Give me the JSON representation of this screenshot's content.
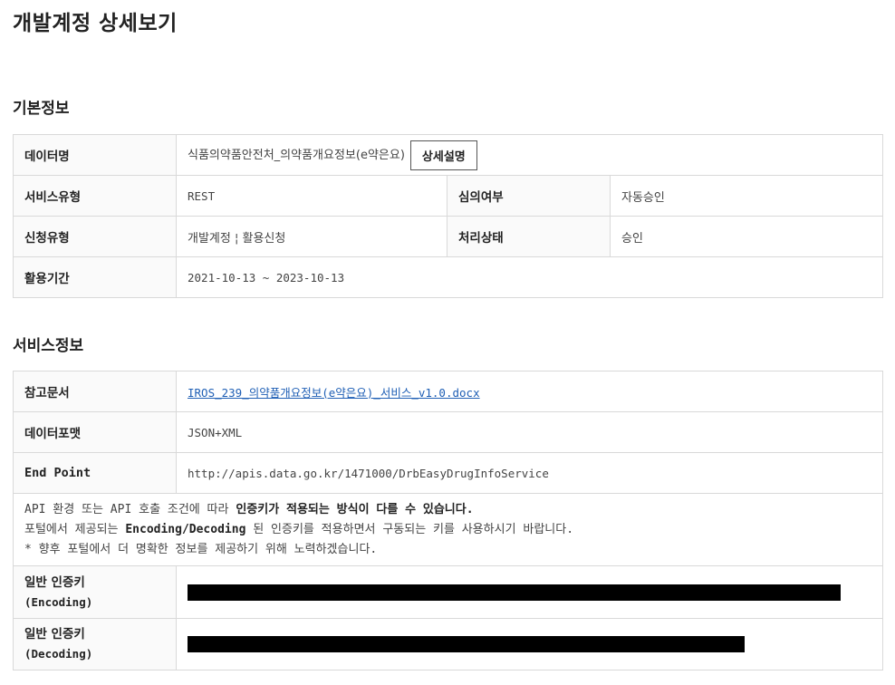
{
  "page": {
    "title": "개발계정 상세보기"
  },
  "basic_info": {
    "section_title": "기본정보",
    "data_name_label": "데이터명",
    "data_name_value": "식품의약품안전처_의약품개요정보(e약은요)",
    "detail_button_label": "상세설명",
    "service_type_label": "서비스유형",
    "service_type_value": "REST",
    "review_label": "심의여부",
    "review_value": "자동승인",
    "request_type_label": "신청유형",
    "request_type_value": "개발계정 ¦ 활용신청",
    "process_status_label": "처리상태",
    "process_status_value": "승인",
    "period_label": "활용기간",
    "period_value": "2021-10-13 ~ 2023-10-13"
  },
  "service_info": {
    "section_title": "서비스정보",
    "reference_doc_label": "참고문서",
    "reference_doc_value": "IROS_239_의약품개요정보(e약은요)_서비스_v1.0.docx",
    "data_format_label": "데이터포맷",
    "data_format_value": "JSON+XML",
    "endpoint_label": "End Point",
    "endpoint_value": "http://apis.data.go.kr/1471000/DrbEasyDrugInfoService",
    "notice_line1_a": "API 환경 또는 API 호출 조건에 따라 ",
    "notice_line1_b": "인증키가 적용되는 방식이 다를 수 있습니다.",
    "notice_line2_a": "포털에서 제공되는 ",
    "notice_line2_b": "Encoding/Decoding",
    "notice_line2_c": " 된 인증키를 적용하면서 구동되는 키를 사용하시기 바랍니다.",
    "notice_line3": "* 향후 포털에서 더 명확한 정보를 제공하기 위해 노력하겠습니다.",
    "key_enc_label": "일반 인증키",
    "key_enc_sub": "(Encoding)",
    "key_dec_label": "일반 인증키",
    "key_dec_sub": "(Decoding)"
  }
}
